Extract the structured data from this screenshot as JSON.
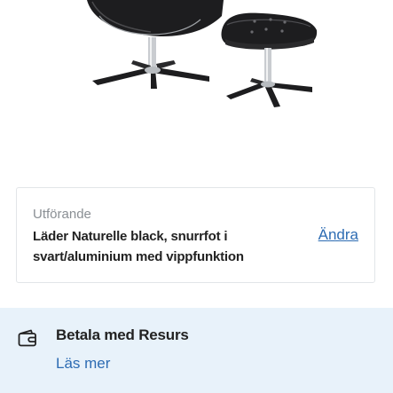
{
  "product": {
    "image_icon": "armchair-with-ottoman-photo"
  },
  "variant": {
    "caption": "Utförande",
    "value": "Läder Naturelle black, snurrfot i svart/aluminium med vippfunktion",
    "change_label": "Ändra"
  },
  "payment": {
    "icon": "wallet-icon",
    "title": "Betala med Resurs",
    "read_more_label": "Läs mer"
  },
  "colors": {
    "link": "#2d6cb3",
    "panel_background": "#e8f2fa",
    "card_border": "#e2e5e8",
    "text": "#222222",
    "muted_text": "#8a8f94"
  }
}
